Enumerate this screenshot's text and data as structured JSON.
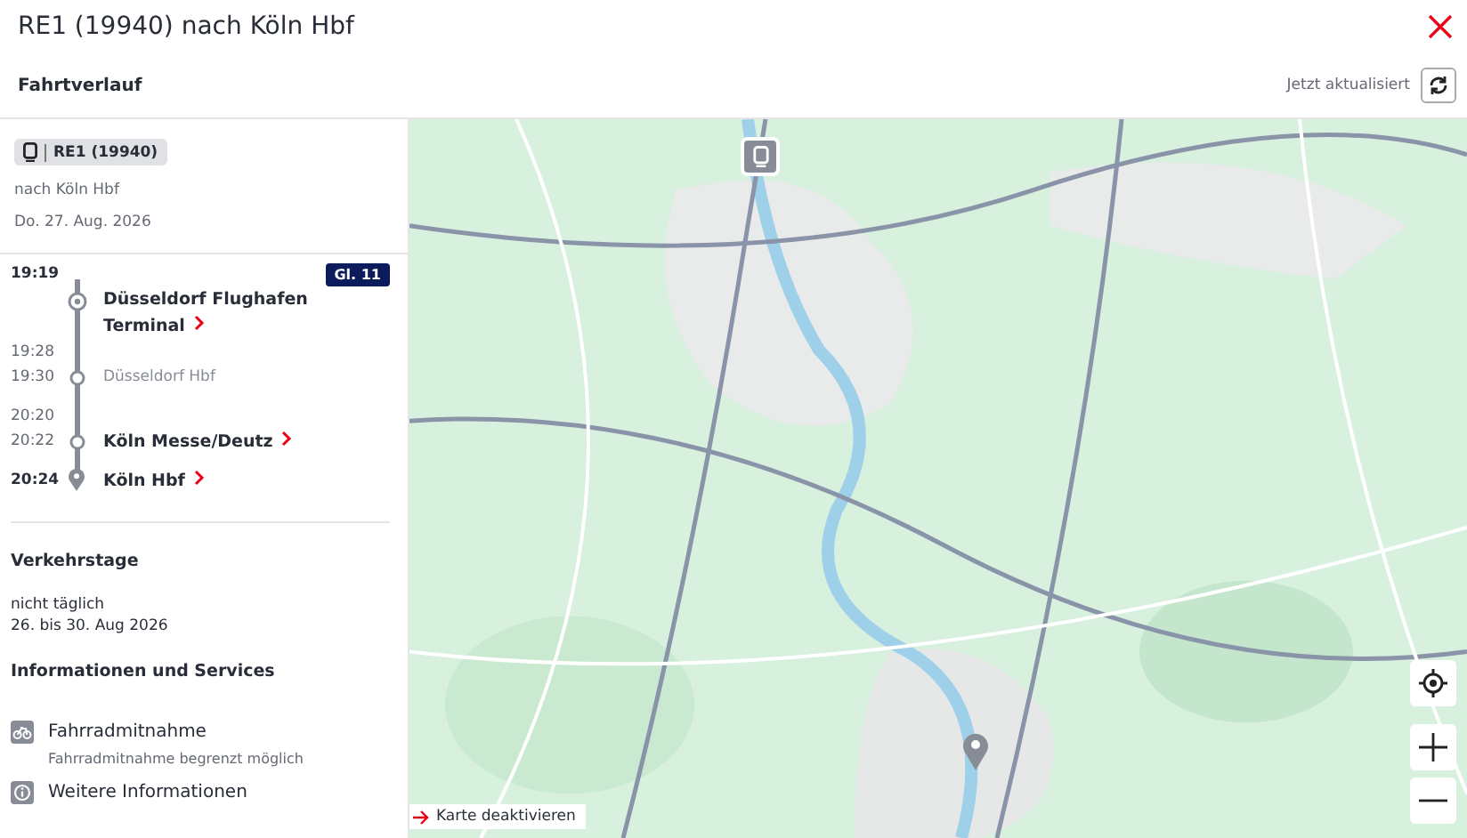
{
  "header": {
    "title": "RE1 (19940) nach Köln Hbf"
  },
  "subheader": {
    "title": "Fahrtverlauf",
    "updated": "Jetzt aktualisiert"
  },
  "train": {
    "badge": "RE1 (19940)",
    "direction": "nach Köln Hbf",
    "date": "Do. 27. Aug. 2026"
  },
  "stops": [
    {
      "kind": "start",
      "times": [
        "19:19"
      ],
      "name": "Düsseldorf Flughafen Terminal",
      "platform": "Gl. 11"
    },
    {
      "kind": "pass",
      "times": [
        "19:28",
        "19:30"
      ],
      "name": "Düsseldorf Hbf"
    },
    {
      "kind": "stop",
      "times": [
        "20:20",
        "20:22"
      ],
      "name": "Köln Messe/Deutz"
    },
    {
      "kind": "end",
      "times": [
        "20:24"
      ],
      "name": "Köln Hbf"
    }
  ],
  "operating_days": {
    "title": "Verkehrstage",
    "lines": [
      "nicht täglich",
      "26. bis 30. Aug 2026"
    ]
  },
  "services": {
    "title": "Informationen und Services",
    "items": [
      {
        "kind": "bike",
        "label": "Fahrradmitnahme",
        "detail": "Fahrradmitnahme begrenzt möglich"
      },
      {
        "kind": "info",
        "label": "Weitere Informationen"
      }
    ]
  },
  "map": {
    "disable_link": "Karte deaktivieren"
  }
}
